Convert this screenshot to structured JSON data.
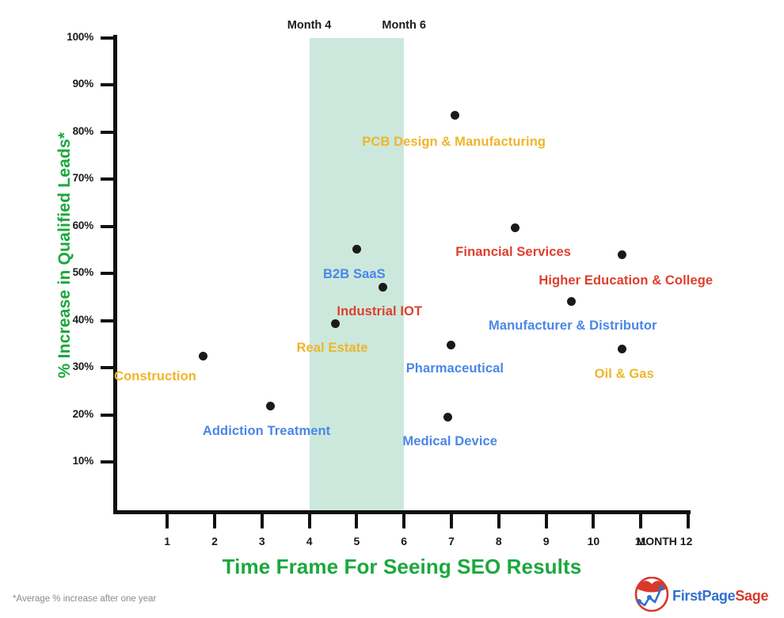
{
  "chart_data": {
    "type": "scatter",
    "title": "",
    "xlabel": "Time Frame For Seeing SEO Results",
    "ylabel": "% Increase in Qualified Leads*",
    "xlim": [
      0,
      12.4
    ],
    "ylim": [
      0,
      100
    ],
    "grid": false,
    "legend": "none",
    "x_tick_labels": [
      "1",
      "2",
      "3",
      "4",
      "5",
      "6",
      "7",
      "8",
      "9",
      "10",
      "11",
      "MONTH 12"
    ],
    "x_tick_values": [
      1,
      2,
      3,
      4,
      5,
      6,
      7,
      8,
      9,
      10,
      11,
      12
    ],
    "y_tick_labels": [
      "10%",
      "20%",
      "30%",
      "40%",
      "50%",
      "60%",
      "70%",
      "80%",
      "90%",
      "100%"
    ],
    "y_tick_values": [
      10,
      20,
      30,
      40,
      50,
      60,
      70,
      80,
      90,
      100
    ],
    "highlight_band": {
      "x_start": 4,
      "x_end": 6,
      "start_label": "Month 4",
      "end_label": "Month 6",
      "color": "#c9e7da"
    },
    "points": [
      {
        "label": "Construction",
        "x": 1.75,
        "y": 32.5,
        "color": "#efb52a",
        "label_dx": -60,
        "label_dy": 17,
        "label_align": "center"
      },
      {
        "label": "Addiction Treatment",
        "x": 3.18,
        "y": 21.8,
        "color": "#4a86e8",
        "label_dx": -5,
        "label_dy": 22,
        "label_align": "center"
      },
      {
        "label": "Real Estate",
        "x": 4.55,
        "y": 39.3,
        "color": "#efb52a",
        "label_dx": -4,
        "label_dy": 21,
        "label_align": "center"
      },
      {
        "label": "B2B SaaS",
        "x": 5.0,
        "y": 55.2,
        "color": "#4a86e8",
        "label_dx": -3,
        "label_dy": 23,
        "label_align": "center"
      },
      {
        "label": "Industrial IOT",
        "x": 5.55,
        "y": 47.1,
        "color": "#e03e2d",
        "label_dx": -4,
        "label_dy": 22,
        "label_align": "center"
      },
      {
        "label": "Medical Device",
        "x": 6.92,
        "y": 19.5,
        "color": "#4a86e8",
        "label_dx": 3,
        "label_dy": 22,
        "label_align": "center"
      },
      {
        "label": "Pharmaceutical",
        "x": 6.99,
        "y": 34.8,
        "color": "#4a86e8",
        "label_dx": 5,
        "label_dy": 21,
        "label_align": "center"
      },
      {
        "label": "PCB Design & Manufacturing",
        "x": 7.07,
        "y": 83.5,
        "color": "#efb52a",
        "label_dx": -1,
        "label_dy": 24,
        "label_align": "center"
      },
      {
        "label": "Financial Services",
        "x": 8.34,
        "y": 59.7,
        "color": "#e03e2d",
        "label_dx": -2,
        "label_dy": 22,
        "label_align": "center"
      },
      {
        "label": "Manufacturer & Distributor",
        "x": 9.53,
        "y": 44.1,
        "color": "#4a86e8",
        "label_dx": 2,
        "label_dy": 22,
        "label_align": "center"
      },
      {
        "label": "Oil & Gas",
        "x": 10.6,
        "y": 33.9,
        "color": "#efb52a",
        "label_dx": 3,
        "label_dy": 22,
        "label_align": "center"
      },
      {
        "label": "Higher Education & College",
        "x": 10.6,
        "y": 54.0,
        "color": "#e03e2d",
        "label_dx": 5,
        "label_dy": 24,
        "label_align": "center"
      }
    ]
  },
  "footnote": "*Average % increase after one year",
  "logo": {
    "word_first": "First",
    "word_page": "Page",
    "word_sage": "Sage",
    "brand_blue": "#2f6fd0",
    "brand_red": "#d8392b"
  },
  "accent_green": "#1aa83c"
}
